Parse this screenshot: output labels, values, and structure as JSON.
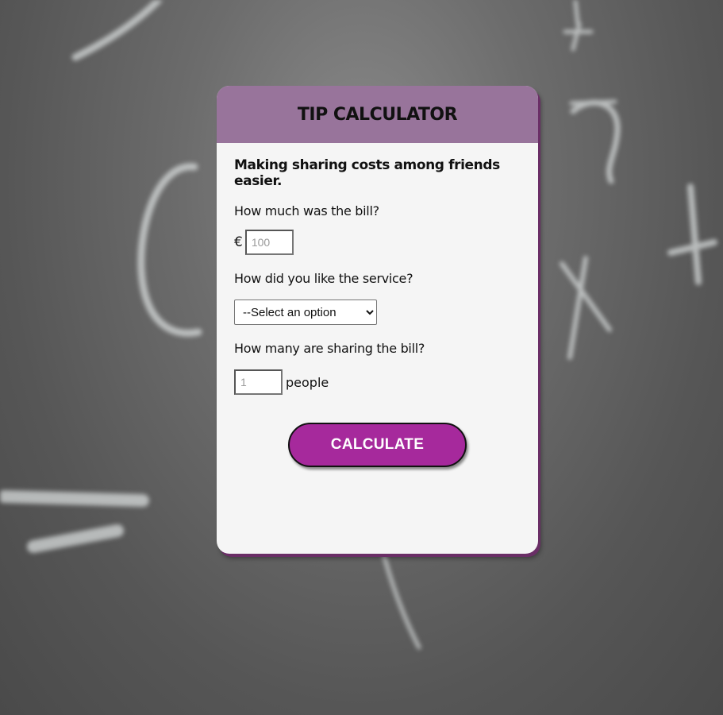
{
  "header": {
    "title": "TIP CALCULATOR"
  },
  "intro": {
    "tagline": "Making sharing costs among friends easier."
  },
  "bill": {
    "question": "How much was the bill?",
    "currency_symbol": "€",
    "placeholder": "100"
  },
  "service": {
    "question": "How did you like the service?",
    "selected_option": "--Select an option"
  },
  "sharing": {
    "question": "How many are sharing the bill?",
    "placeholder": "1",
    "unit_label": "people"
  },
  "actions": {
    "calculate_label": "CALCULATE"
  },
  "colors": {
    "header_bg": "#98749b",
    "button_bg": "#a6299c",
    "card_bg": "#f5f5f5"
  }
}
